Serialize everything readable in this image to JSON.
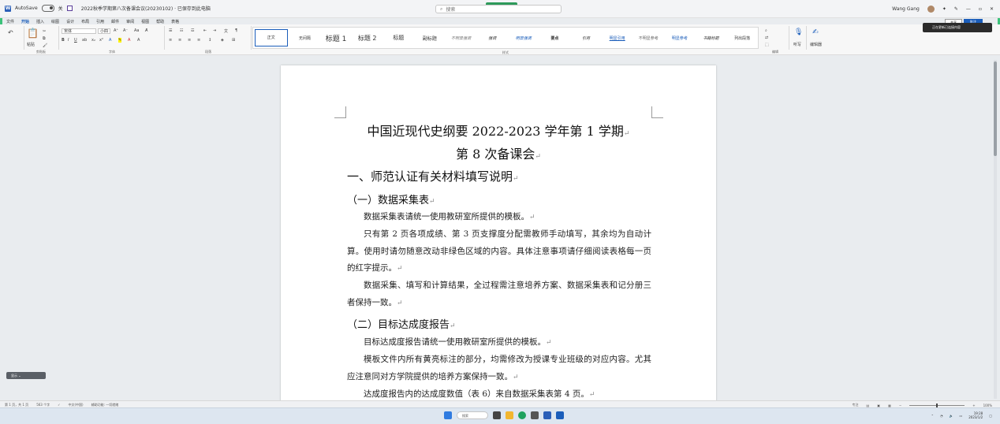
{
  "titlebar": {
    "app_name": "AutoSave",
    "autosave_state": "关",
    "document_title": "2022秋季学期第八次备课会议(20230102) · 已保存到此电脑",
    "search_placeholder": "搜索",
    "status_pill": "",
    "user_name": "Wang Gang"
  },
  "ribbon_tabs": [
    "文件",
    "开始",
    "插入",
    "绘图",
    "设计",
    "布局",
    "引用",
    "邮件",
    "审阅",
    "视图",
    "帮助",
    "表格"
  ],
  "ribbon": {
    "paste_label": "粘贴",
    "clipboard_group": "剪贴板",
    "font_name": "宋体",
    "font_size": "小四",
    "font_group": "字体",
    "paragraph_group": "段落",
    "styles_group": "样式",
    "editing_group": "编辑",
    "dictate_label": "听写",
    "editor_label": "编辑器",
    "styles": [
      "正文",
      "无间隔",
      "标题 1",
      "标题 2",
      "标题",
      "副标题",
      "不明显强调",
      "强调",
      "明显强调",
      "要点",
      "引用",
      "明显引用",
      "不明显参考",
      "明显参考",
      "书籍标题",
      "列出段落"
    ],
    "share_label": "共享",
    "comments_label": "批注",
    "notification": "正在更新已连接内容"
  },
  "document": {
    "title_line1": "中国近现代史纲要 2022-2023 学年第 1 学期",
    "title_line2": "第 8 次备课会",
    "heading1": "一、师范认证有关材料填写说明",
    "heading2a": "（一）数据采集表",
    "p1": "数据采集表请统一使用教研室所提供的模板。",
    "p2": "只有第 2 页各项成绩、第 3 页支撑度分配需教师手动填写，其余均为自动计算。使用时请勿随意改动非绿色区域的内容。具体注意事项请仔细阅读表格每一页的红字提示。",
    "p3": "数据采集、填写和计算结果，全过程需注意培养方案、数据采集表和记分册三者保持一致。",
    "heading2b": "（二）目标达成度报告",
    "p4": "目标达成度报告请统一使用教研室所提供的模板。",
    "p5": "模板文件内所有黄亮标注的部分，均需修改为授课专业班级的对应内容。尤其应注意同对方学院提供的培养方案保持一致。",
    "p6": "达成度报告内的达成度数值（表 6）来自数据采集表第 4 页。",
    "paragraph_mark": "↵"
  },
  "floating_pill": "显示  ⌄",
  "statusbar": {
    "page": "第 1 页，共 1 页",
    "words": "563 个字",
    "language": "中文(中国)",
    "accessibility": "辅助功能: 一切就绪",
    "focus": "专注",
    "zoom": "100%"
  },
  "taskbar": {
    "search_label": "搜索",
    "time": "19:28",
    "date": "2023/1/2"
  }
}
